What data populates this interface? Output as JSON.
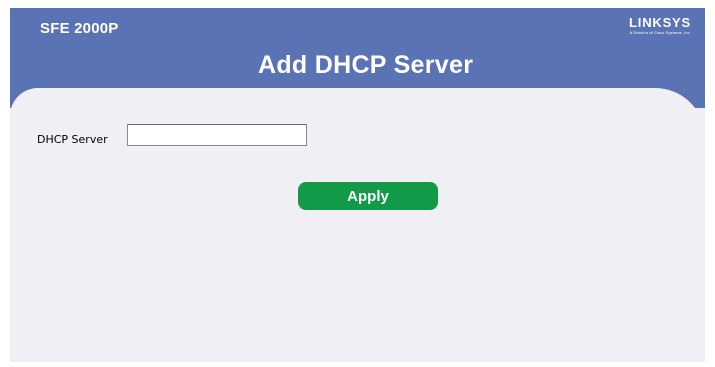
{
  "header": {
    "device_model": "SFE 2000P",
    "brand_name": "LINKSYS",
    "brand_tagline": "A Division of Cisco Systems, Inc.",
    "page_title": "Add DHCP Server"
  },
  "form": {
    "dhcp_server_label": "DHCP Server",
    "dhcp_server_value": "",
    "apply_label": "Apply"
  },
  "colors": {
    "header_blue": "#5a73b5",
    "apply_green": "#129a48",
    "content_bg": "#f0f0f4"
  }
}
